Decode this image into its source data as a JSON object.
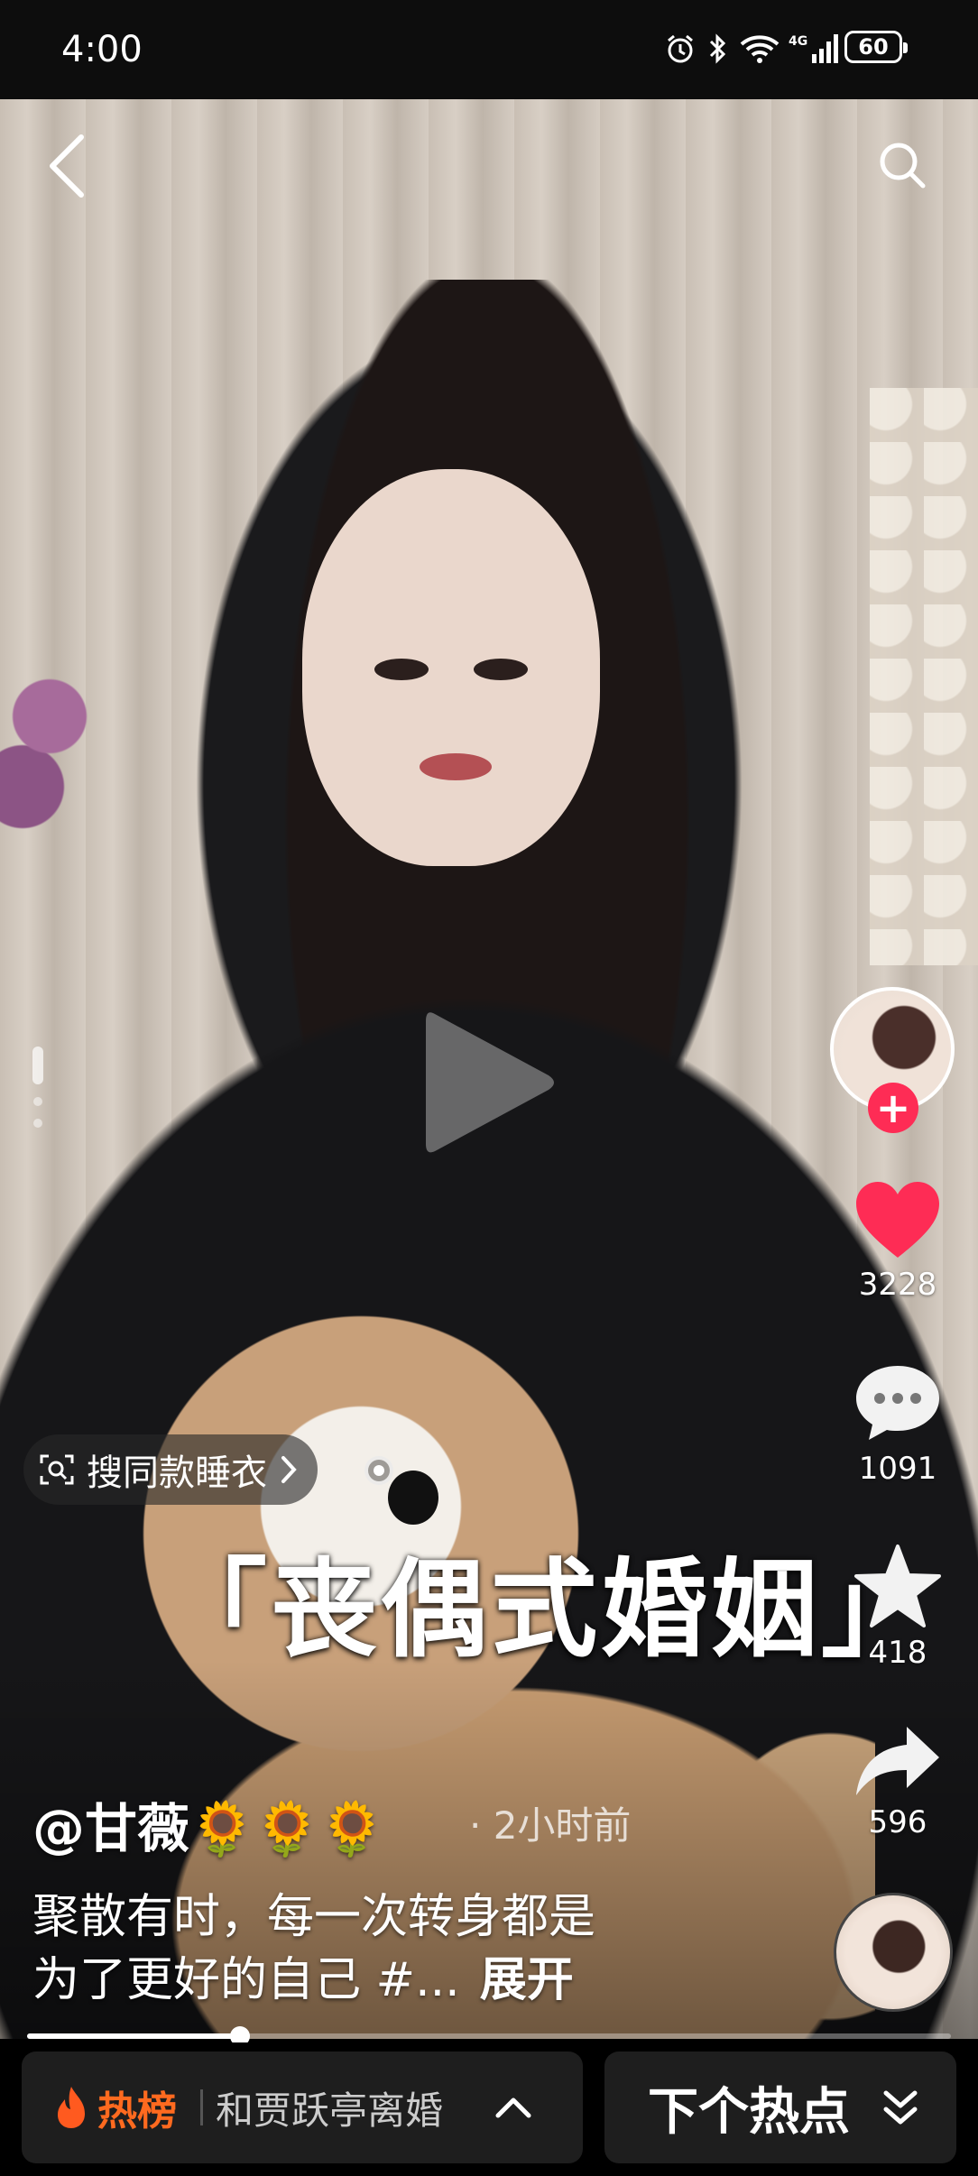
{
  "status_bar": {
    "time": "4:00",
    "network": "4G",
    "battery": "60",
    "icons": [
      "alarm-icon",
      "bluetooth-icon",
      "wifi-icon",
      "signal-icon",
      "battery-icon"
    ]
  },
  "top_nav": {
    "back_icon": "chevron-left-icon",
    "search_icon": "search-icon"
  },
  "video": {
    "caption": "「丧偶式婚姻」",
    "search_same_chip": "搜同款睡衣",
    "progress": 0.23
  },
  "author": {
    "name": "@甘薇🌻🌻🌻",
    "post_time": "· 2小时前"
  },
  "description": {
    "line1": "聚散有时，每一次转身都是",
    "line2": "为了更好的自己 #...",
    "expand_label": "展开"
  },
  "actions": {
    "follow_icon": "+",
    "like_count": "3228",
    "comment_count": "1091",
    "favorite_count": "418",
    "share_count": "596"
  },
  "bottom_bar": {
    "hot_list_label": "热榜",
    "hot_topic": "和贾跃亭离婚",
    "next_hot_label": "下个热点"
  },
  "colors": {
    "like": "#fe2c55",
    "follow": "#fe2c55",
    "hot_list": "#ff6a1f"
  }
}
